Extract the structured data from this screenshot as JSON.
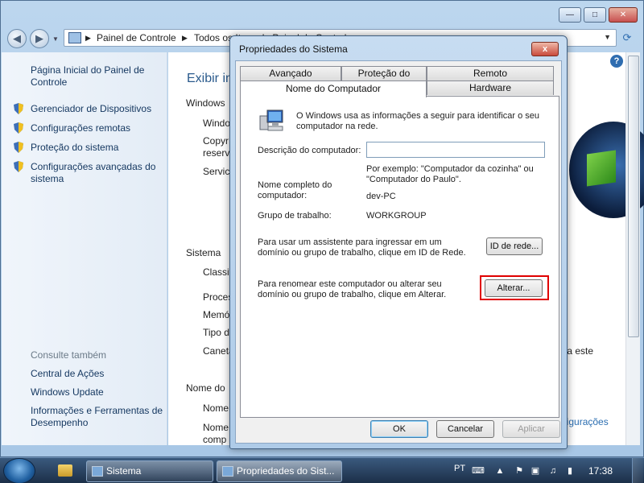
{
  "address": {
    "crumb1": "Painel de Controle",
    "crumb2": "Todos os Itens do Painel de Controle"
  },
  "left_pane": {
    "home": "Página Inicial do Painel de Controle",
    "tasks": [
      "Gerenciador de Dispositivos",
      "Configurações remotas",
      "Proteção do sistema",
      "Configurações avançadas do sistema"
    ],
    "see_also_title": "Consulte também",
    "see_also": [
      "Central de Ações",
      "Windows Update",
      "Informações e Ferramentas de Desempenho"
    ]
  },
  "content": {
    "title": "Exibir informações básicas sobre o computador",
    "sections": {
      "edition": "Windows",
      "system": "Sistema",
      "computer_name": "Nome do"
    },
    "rows_edition": [
      "Windo",
      "Copyr\nreserva",
      "Servic"
    ],
    "rows_system": [
      "Classif",
      "Proces",
      "Memó",
      "Tipo d",
      "Caneta"
    ],
    "rows_name": [
      "Nome",
      "Nome\ncomp"
    ],
    "fragment_text": "para este",
    "fragment_link": "onfigurações"
  },
  "dialog": {
    "title": "Propriedades do Sistema",
    "close": "x",
    "tabs": {
      "advanced": "Avançado",
      "protection": "Proteção do Sistema",
      "remote": "Remoto",
      "computer_name": "Nome do Computador",
      "hardware": "Hardware"
    },
    "intro": "O Windows usa as informações a seguir para identificar o seu computador na rede.",
    "description_label": "Descrição do computador:",
    "description_value": "",
    "description_example": "Por exemplo: \"Computador da cozinha\" ou \"Computador do Paulo\".",
    "full_name_label": "Nome completo do computador:",
    "full_name_value": "dev-PC",
    "workgroup_label": "Grupo de trabalho:",
    "workgroup_value": "WORKGROUP",
    "network_id_text": "Para usar um assistente para ingressar em um domínio ou grupo de trabalho, clique em ID de Rede.",
    "network_id_button": "ID de rede...",
    "change_text": "Para renomear este computador ou alterar seu domínio ou grupo de trabalho, clique em Alterar.",
    "change_button": "Alterar...",
    "ok": "OK",
    "cancel": "Cancelar",
    "apply": "Aplicar"
  },
  "taskbar": {
    "tasks": [
      "Sistema",
      "Propriedades do Sist..."
    ],
    "language": "PT",
    "clock": "17:38"
  },
  "colors": {
    "highlight": "#e00000",
    "link": "#13365f",
    "title_blue": "#2a5a8c"
  }
}
